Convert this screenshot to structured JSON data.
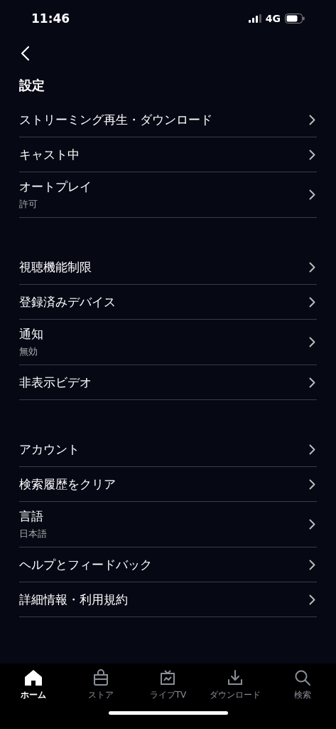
{
  "status_bar": {
    "time": "11:46",
    "network": "4G"
  },
  "title": "設定",
  "sections": [
    {
      "items": [
        {
          "label": "ストリーミング再生・ダウンロード"
        },
        {
          "label": "キャスト中"
        },
        {
          "label": "オートプレイ",
          "value": "許可"
        }
      ]
    },
    {
      "items": [
        {
          "label": "視聴機能制限"
        },
        {
          "label": "登録済みデバイス"
        },
        {
          "label": "通知",
          "value": "無効"
        },
        {
          "label": "非表示ビデオ"
        }
      ]
    },
    {
      "items": [
        {
          "label": "アカウント"
        },
        {
          "label": "検索履歴をクリア"
        },
        {
          "label": "言語",
          "value": "日本語"
        },
        {
          "label": "ヘルプとフィードバック"
        },
        {
          "label": "詳細情報・利用規約"
        }
      ]
    }
  ],
  "tabs": [
    {
      "kind": "home",
      "label": "ホーム",
      "selected": true
    },
    {
      "kind": "store",
      "label": "ストア",
      "selected": false
    },
    {
      "kind": "live",
      "label": "ライブTV",
      "selected": false
    },
    {
      "kind": "download",
      "label": "ダウンロード",
      "selected": false
    },
    {
      "kind": "search",
      "label": "検索",
      "selected": false
    }
  ]
}
